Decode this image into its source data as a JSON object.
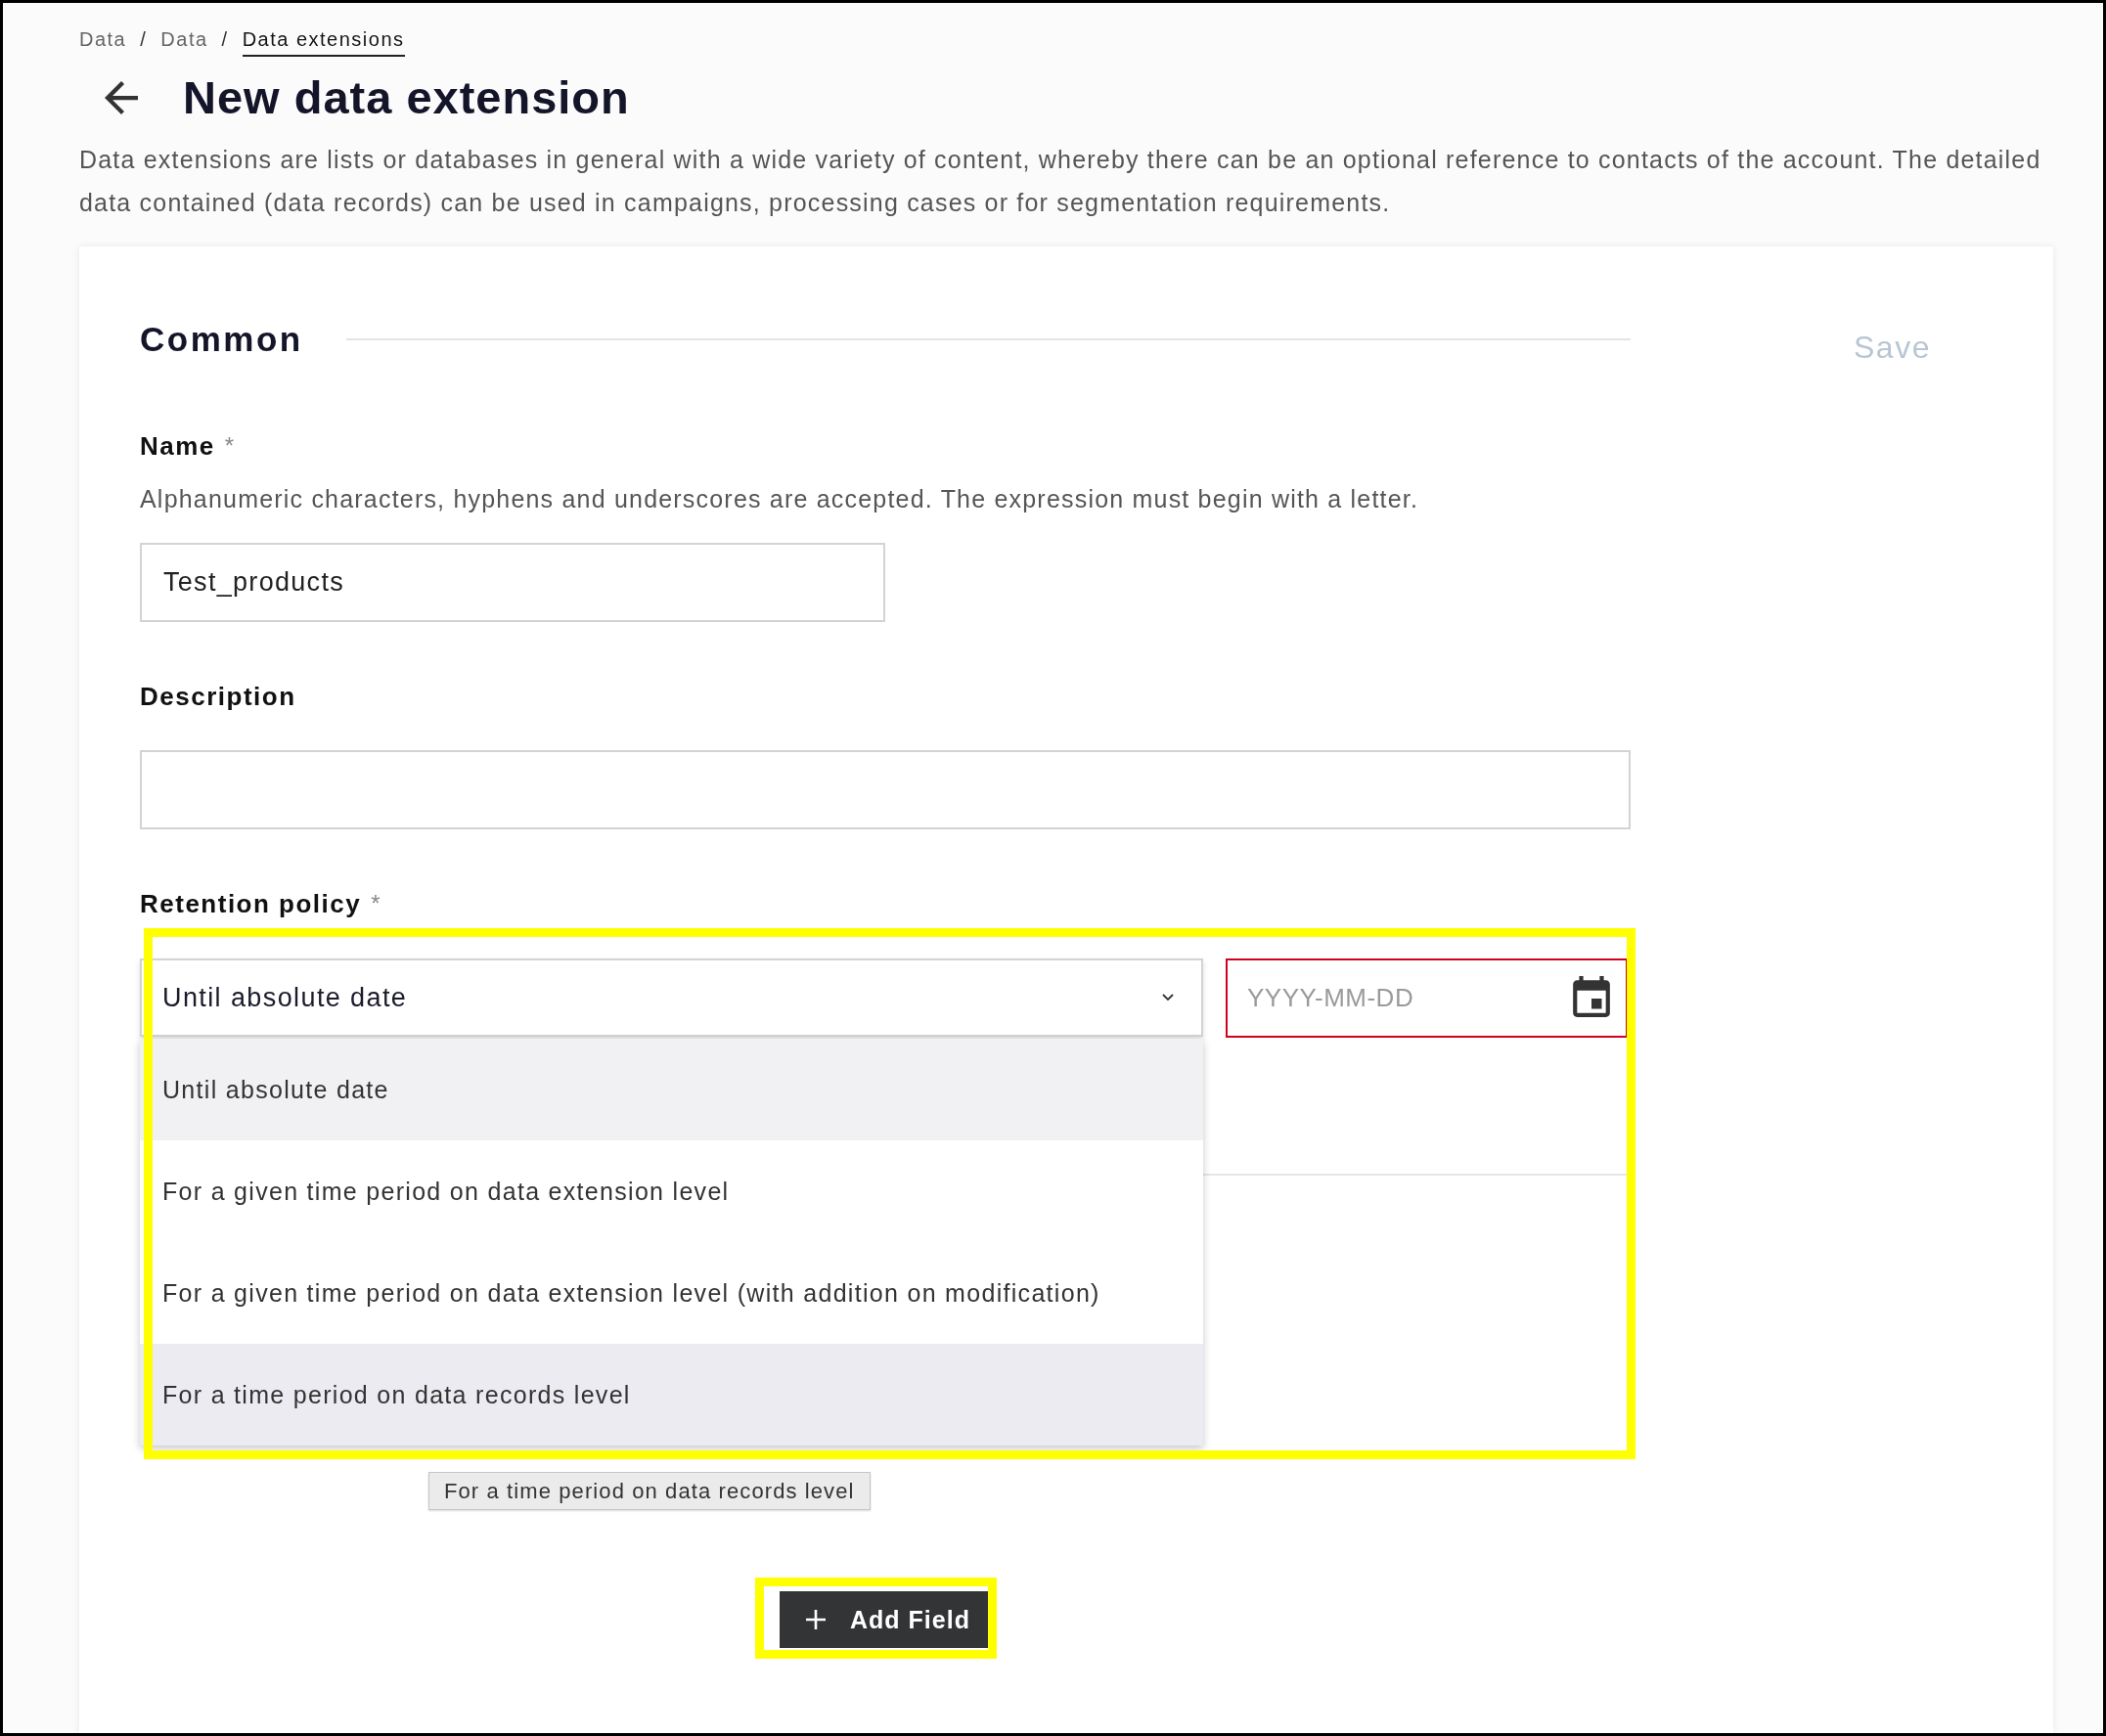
{
  "breadcrumb": [
    {
      "label": "Data",
      "current": false
    },
    {
      "separator": "/",
      "label": "Data",
      "current": false
    },
    {
      "separator": "/",
      "label": "Data extensions",
      "current": true
    }
  ],
  "header": {
    "title": "New data extension",
    "description": "Data extensions are lists or databases in general with a wide variety of content, whereby there can be an optional reference to contacts of the account. The detailed data contained (data records) can be used in campaigns, processing cases or for segmentation requirements."
  },
  "form": {
    "section_title": "Common",
    "save_button": {
      "label": "Save",
      "disabled": true
    },
    "fields": [
      {
        "kind": "text",
        "label": "Name",
        "required_mark": "*",
        "hint": "Alphanumeric characters, hyphens and underscores are accepted. The expression must begin with a letter.",
        "value": "Test_products"
      },
      {
        "kind": "textarea",
        "label": "Description"
      },
      {
        "kind": "select",
        "label": "Retention policy",
        "required_mark": "*",
        "value": "Until absolute date",
        "expanded": true,
        "highlighted": true,
        "options": [
          {
            "label": "Until absolute date",
            "selected": true,
            "hovered": false
          },
          {
            "label": "For a given time period on data extension level",
            "selected": false,
            "hovered": false
          },
          {
            "label": "For a given time period on data extension level (with addition on modification)",
            "selected": false,
            "hovered": false
          },
          {
            "label": "For a time period on data records level",
            "selected": false,
            "hovered": true
          }
        ],
        "date_field": {
          "placeholder": "YYYY-MM-DD",
          "invalid": true
        },
        "tooltip": "For a time period on data records level"
      }
    ],
    "add_button": {
      "label": "Add Field",
      "highlighted": true
    }
  }
}
